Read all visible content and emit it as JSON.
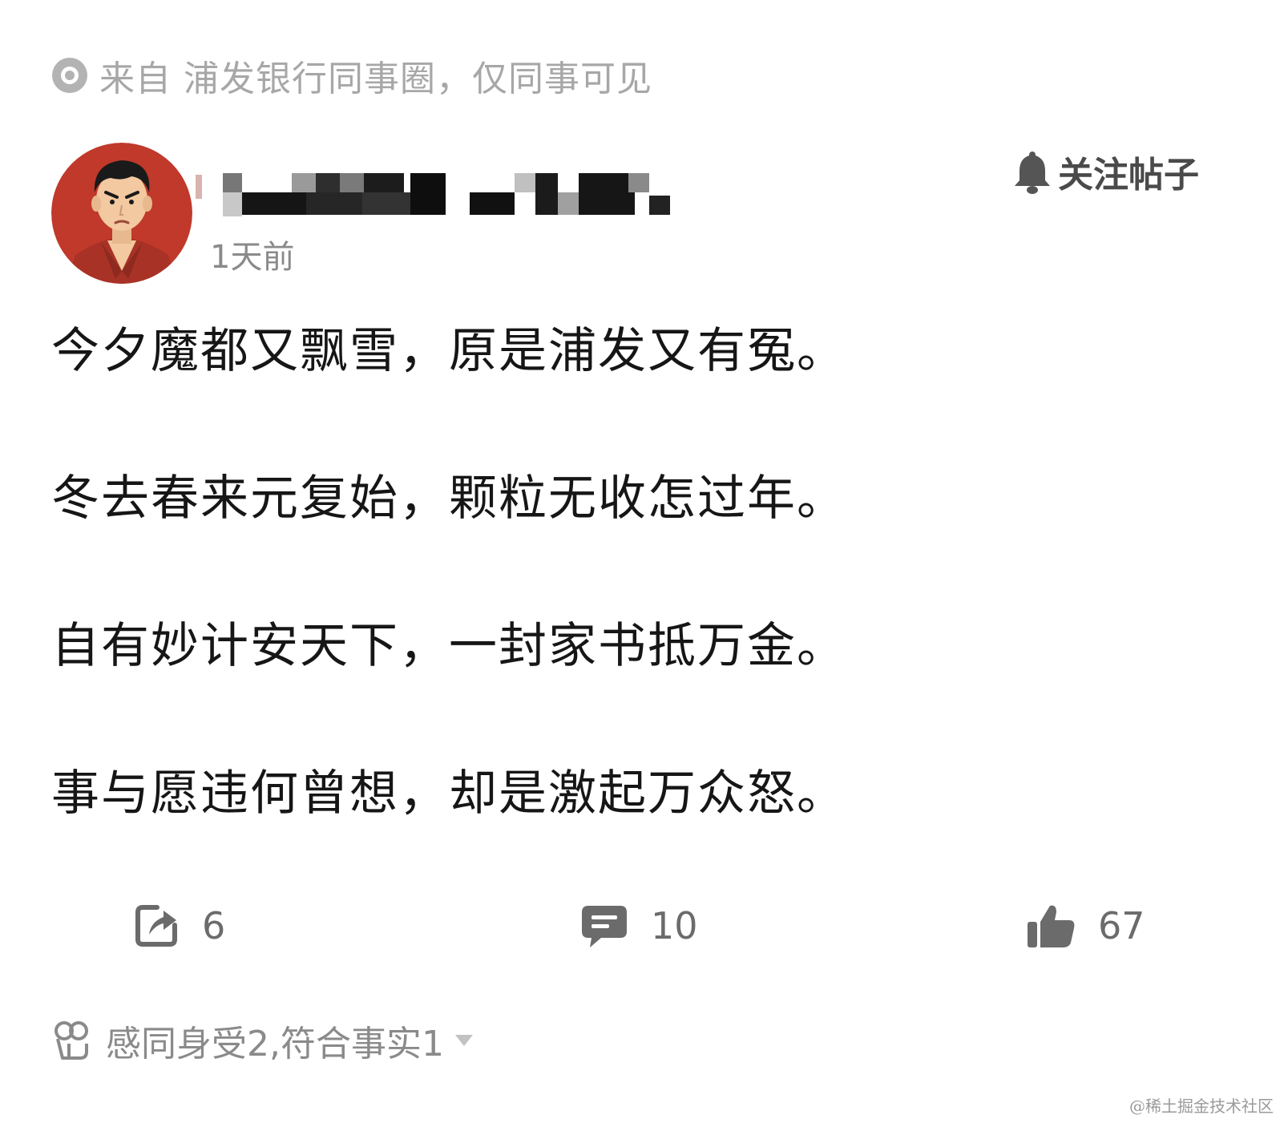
{
  "source": {
    "text": "来自 浦发银行同事圈，仅同事可见",
    "icon": "circle-dot-icon"
  },
  "post": {
    "author_avatar": "avatar-cartoon-man",
    "author_name_masked": true,
    "time": "1天前",
    "follow_label": "关注帖子",
    "follow_icon": "bell-icon",
    "poem": [
      "今夕魔都又飘雪，原是浦发又有冤。",
      "冬去春来元复始，颗粒无收怎过年。",
      "自有妙计安天下，一封家书抵万金。",
      "事与愿违何曾想，却是激起万众怒。"
    ]
  },
  "actions": {
    "share_count": "6",
    "comment_count": "10",
    "like_count": "67"
  },
  "reactions": {
    "text": "感同身受2,符合事实1",
    "icon": "reaction-flower-icon"
  },
  "watermark": "@稀土掘金技术社区",
  "colors": {
    "text_primary": "#161616",
    "text_secondary": "#8a8a8a",
    "source_gray": "#a7a7a7",
    "avatar_bg": "#c0392b"
  }
}
